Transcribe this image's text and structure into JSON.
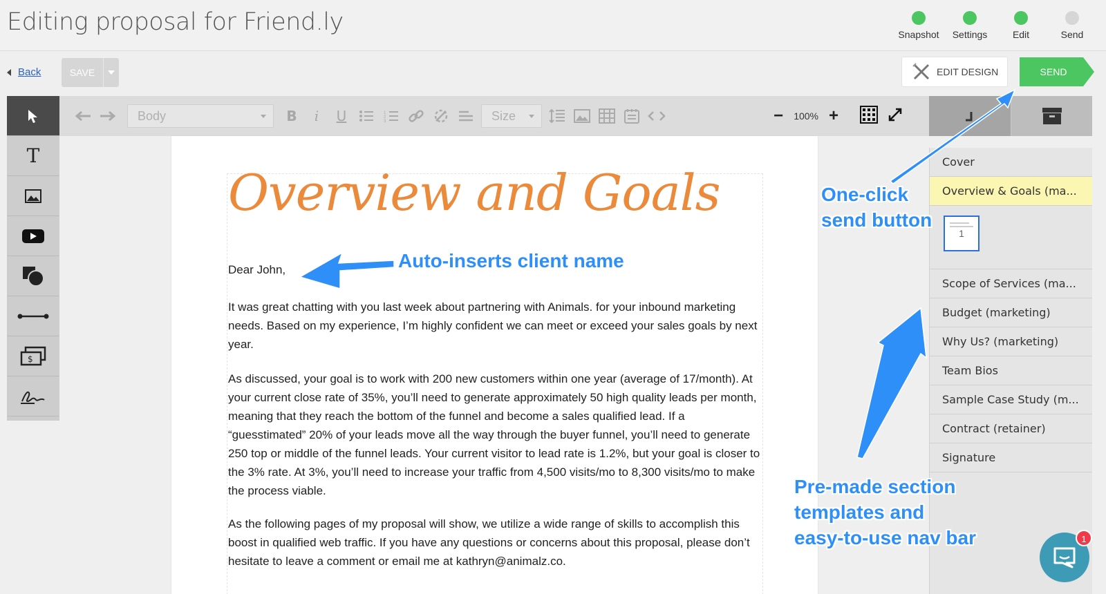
{
  "header": {
    "title": "Editing proposal for Friend.ly",
    "steps": [
      {
        "label": "Snapshot",
        "done": true
      },
      {
        "label": "Settings",
        "done": true
      },
      {
        "label": "Edit",
        "done": true
      },
      {
        "label": "Send",
        "done": false
      }
    ]
  },
  "actions": {
    "back_label": "Back",
    "save_label": "SAVE",
    "edit_design_label": "EDIT DESIGN",
    "send_label": "SEND"
  },
  "toolbar": {
    "style_select": "Body",
    "size_select": "Size",
    "zoom": "100%"
  },
  "sections": {
    "items": [
      "Cover",
      "Overview & Goals (ma...",
      "Scope of Services (ma...",
      "Budget (marketing)",
      "Why Us? (marketing)",
      "Team Bios",
      "Sample Case Study (m...",
      "Contract (retainer)",
      "Signature"
    ],
    "thumb_page": "1"
  },
  "document": {
    "title": "Overview and Goals",
    "greeting": "Dear John,",
    "paragraphs": [
      "It was great chatting with you last week about partnering with Animals. for your inbound marketing needs. Based on my experience, I’m highly confident we can meet or exceed your sales goals by next year.",
      "As discussed, your goal is to work with 200 new customers within one year (average of 17/month). At your current close rate of 35%, you’ll need to generate approximately 50 high quality leads per month, meaning that they reach the bottom of the funnel and become a sales qualified lead. If a “guesstimated” 20% of your leads move all the way through the buyer funnel, you’ll need to generate 250 top or middle of the funnel leads. Your current visitor to lead rate is 1.2%, but your goal is closer to the 3% rate. At 3%, you’ll need to increase your traffic from 4,500 visits/mo to 8,300 visits/mo to make the process viable.",
      "As the following pages of my proposal will show, we utilize a wide range of skills to accomplish this boost in qualified web traffic. If you have any questions or concerns about this proposal, please don’t hesitate to leave a comment or email me at kathryn@animalz.co."
    ]
  },
  "annotations": {
    "client_name": "Auto-inserts client name",
    "send_line1": "One-click",
    "send_line2": "send button",
    "nav_line1": "Pre-made section",
    "nav_line2": "templates and",
    "nav_line3": "easy-to-use nav bar"
  },
  "chat": {
    "badge": "1"
  },
  "colors": {
    "step_done": "#4cc660",
    "send_button": "#4cc660",
    "title_orange": "#ea8a3a",
    "annotation_blue": "#2d8ff7",
    "active_section": "#fbf6b1"
  }
}
